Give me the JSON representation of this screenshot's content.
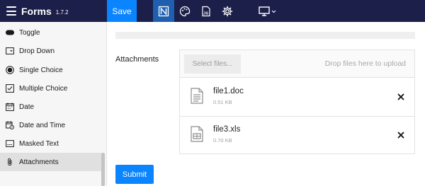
{
  "app": {
    "title": "Forms",
    "version": "1.7.2",
    "save_label": "Save"
  },
  "toolbar": {
    "tools": [
      {
        "icon": "notion-style-n-icon",
        "active": true
      },
      {
        "icon": "palette-icon",
        "active": false
      },
      {
        "icon": "js-file-icon",
        "active": false
      },
      {
        "icon": "gear-icon",
        "active": false
      },
      {
        "icon": "desktop-monitor-icon",
        "active": false
      }
    ]
  },
  "sidebar": {
    "items": [
      {
        "label": "Toggle",
        "icon": "toggle-icon"
      },
      {
        "label": "Drop Down",
        "icon": "dropdown-icon"
      },
      {
        "label": "Single Choice",
        "icon": "radio-icon"
      },
      {
        "label": "Multiple Choice",
        "icon": "checkbox-icon"
      },
      {
        "label": "Date",
        "icon": "calendar-icon"
      },
      {
        "label": "Date and Time",
        "icon": "calendar-clock-icon"
      },
      {
        "label": "Masked Text",
        "icon": "masked-text-icon"
      },
      {
        "label": "Attachments",
        "icon": "paperclip-icon",
        "active": true
      }
    ]
  },
  "main": {
    "field_label": "Attachments",
    "uploader": {
      "select_label": "Select files...",
      "drop_hint": "Drop files here to upload",
      "files": [
        {
          "name": "file1.doc",
          "size": "0.51 KB",
          "icon": "document-file-icon"
        },
        {
          "name": "file3.xls",
          "size": "0.70 KB",
          "icon": "spreadsheet-file-icon"
        }
      ]
    },
    "submit_label": "Submit"
  },
  "colors": {
    "topbar": "#1c1f4a",
    "accent": "#0a84ff"
  }
}
